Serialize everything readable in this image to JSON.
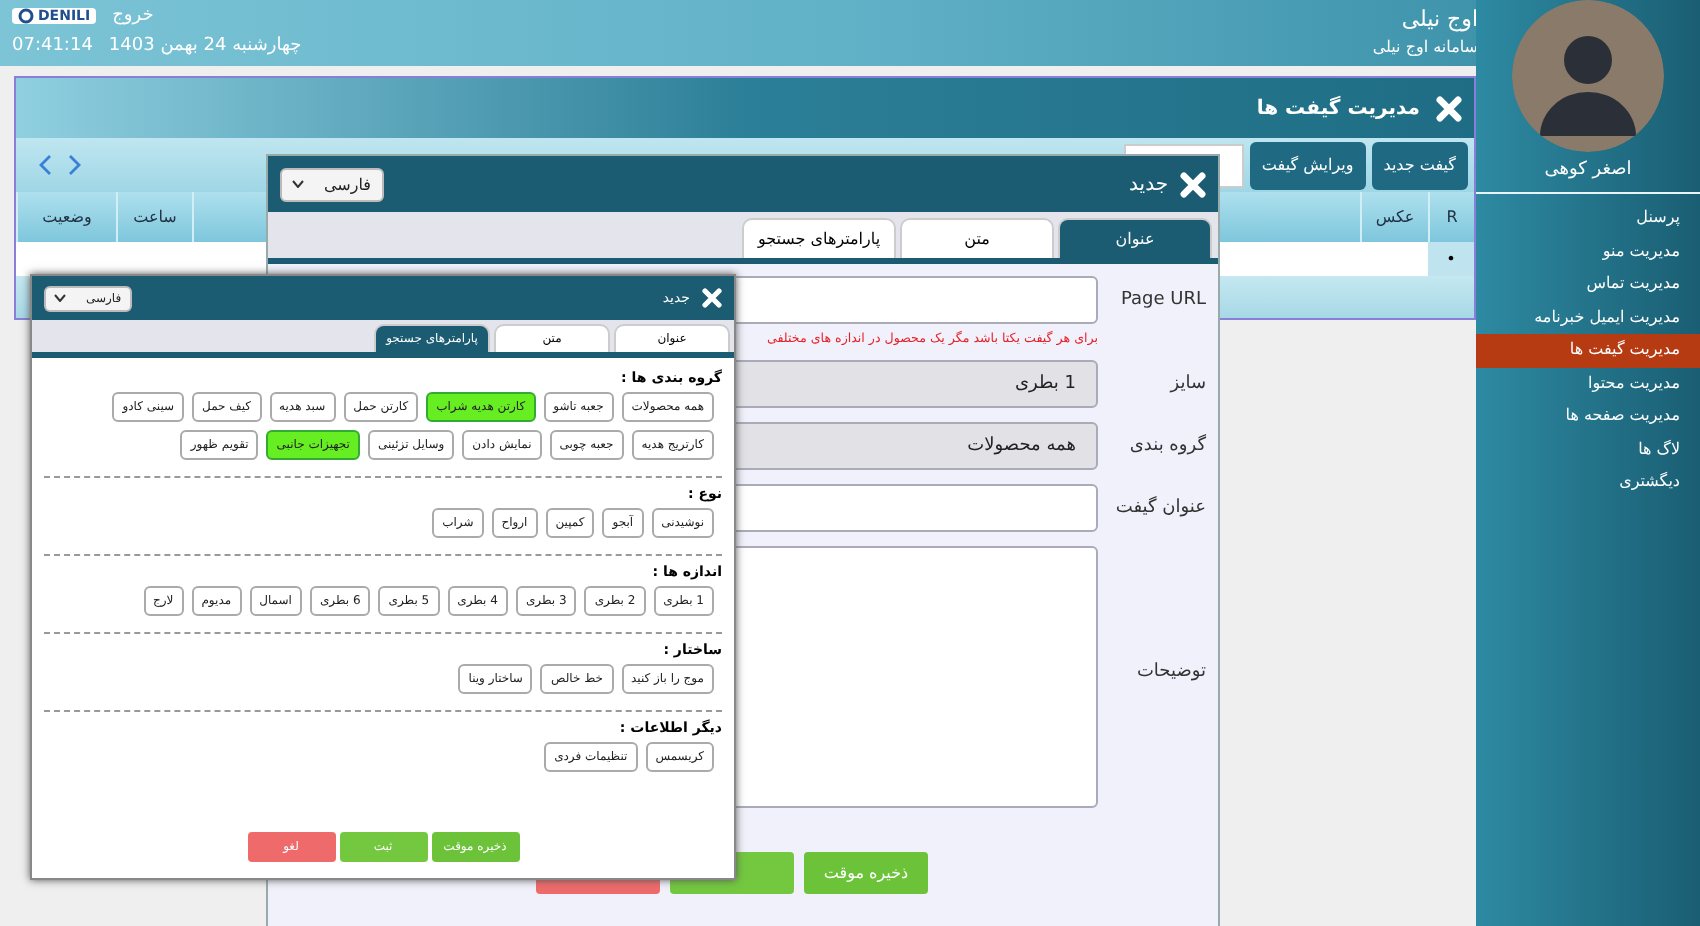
{
  "header": {
    "title": "اوج نیلی",
    "subtitle": "سامانه اوج نیلی",
    "logo": "DENILI",
    "logout": "خروج",
    "date": "چهارشنبه 24 بهمن 1403",
    "time": "07:41:14"
  },
  "sidebar": {
    "user_name": "اصغر کوهی",
    "items": [
      {
        "label": "پرسنل",
        "selected": false
      },
      {
        "label": "مدیریت منو",
        "selected": false
      },
      {
        "label": "مدیریت تماس",
        "selected": false
      },
      {
        "label": "مدیریت ایمیل خبرنامه",
        "selected": false
      },
      {
        "label": "مدیریت گیفت ها",
        "selected": true
      },
      {
        "label": "مدیریت محتوا",
        "selected": false
      },
      {
        "label": "مدیریت صفحه ها",
        "selected": false
      },
      {
        "label": "لاگ ها",
        "selected": false
      },
      {
        "label": "دیگشتری",
        "selected": false
      }
    ]
  },
  "main_window": {
    "title": "مدیریت گیفت ها",
    "toolbar_buttons": [
      "گیفت جدید",
      "ویرایش گیفت"
    ],
    "table": {
      "columns": [
        {
          "label": "R",
          "kind": "marker"
        },
        {
          "label": "عکس",
          "kind": "photo"
        },
        {
          "label": "ساعت",
          "kind": "time"
        },
        {
          "label": "وضعیت",
          "kind": "status"
        }
      ],
      "rows": [
        {
          "marker": "•"
        }
      ]
    }
  },
  "dialog": {
    "title": "جدید",
    "language": "فارسی",
    "tabs": [
      {
        "label": "عنوان",
        "selected": true
      },
      {
        "label": "متن",
        "selected": false
      },
      {
        "label": "پارامترهای جستجو",
        "selected": false
      }
    ],
    "fields": [
      {
        "label": "Page URL",
        "kind": "input",
        "note": "برای هر گیفت یکتا باشد مگر یک محصول در اندازه های مختلفی"
      },
      {
        "label": "سایز",
        "kind": "select",
        "value": "1 بطری"
      },
      {
        "label": "گروه بندی",
        "kind": "select",
        "value": "همه محصولات"
      },
      {
        "label": "عنوان گیفت",
        "kind": "input"
      },
      {
        "label": "توضیحات",
        "kind": "textarea"
      }
    ],
    "buttons": [
      {
        "label": "ذخیره موقت",
        "kind": "save"
      },
      {
        "kind": "submit"
      },
      {
        "kind": "cancel"
      }
    ]
  },
  "search_dialog": {
    "title": "جدید",
    "language": "فارسی",
    "tabs": [
      {
        "label": "عنوان",
        "selected": false
      },
      {
        "label": "متن",
        "selected": false
      },
      {
        "label": "پارامترهای جستجو",
        "selected": true
      }
    ],
    "sections": [
      {
        "title": "گروه بندی ها :",
        "options": [
          {
            "label": "همه محصولات",
            "selected": false
          },
          {
            "label": "جعبه تاشو",
            "selected": false
          },
          {
            "label": "کارتن هدیه شراب",
            "selected": true
          },
          {
            "label": "کارتن حمل",
            "selected": false
          },
          {
            "label": "سبد هدیه",
            "selected": false
          },
          {
            "label": "کیف حمل",
            "selected": false
          },
          {
            "label": "سینی کادو",
            "selected": false
          },
          {
            "label": "کارتریج هدیه",
            "selected": false
          },
          {
            "label": "جعبه چوبی",
            "selected": false
          },
          {
            "label": "نمایش دادن",
            "selected": false
          },
          {
            "label": "وسایل تزئینی",
            "selected": false
          },
          {
            "label": "تجهیزات جانبی",
            "selected": true
          },
          {
            "label": "تقویم ظهور",
            "selected": false
          }
        ]
      },
      {
        "title": "نوع :",
        "options": [
          {
            "label": "نوشیدنی",
            "selected": false
          },
          {
            "label": "آبجو",
            "selected": false
          },
          {
            "label": "کمپین",
            "selected": false
          },
          {
            "label": "ارواح",
            "selected": false
          },
          {
            "label": "شراب",
            "selected": false
          }
        ]
      },
      {
        "title": "اندازه ها :",
        "options": [
          {
            "label": "1 بطری",
            "selected": false
          },
          {
            "label": "2 بطری",
            "selected": false
          },
          {
            "label": "3 بطری",
            "selected": false
          },
          {
            "label": "4 بطری",
            "selected": false
          },
          {
            "label": "5 بطری",
            "selected": false
          },
          {
            "label": "6 بطری",
            "selected": false
          },
          {
            "label": "اسمال",
            "selected": false
          },
          {
            "label": "مدیوم",
            "selected": false
          },
          {
            "label": "لارج",
            "selected": false
          }
        ]
      },
      {
        "title": "ساختار :",
        "options": [
          {
            "label": "موج را باز کنید",
            "selected": false
          },
          {
            "label": "خط خالص",
            "selected": false
          },
          {
            "label": "ساختار وینا",
            "selected": false
          }
        ]
      },
      {
        "title": "دیگر اطلاعات :",
        "options": [
          {
            "label": "کریسمس",
            "selected": false
          },
          {
            "label": "تنظیمات فردی",
            "selected": false
          }
        ]
      }
    ],
    "buttons": [
      {
        "label": "ذخیره موقت",
        "kind": "save"
      },
      {
        "label": "ثبت",
        "kind": "submit"
      },
      {
        "label": "لغو",
        "kind": "cancel"
      }
    ]
  }
}
